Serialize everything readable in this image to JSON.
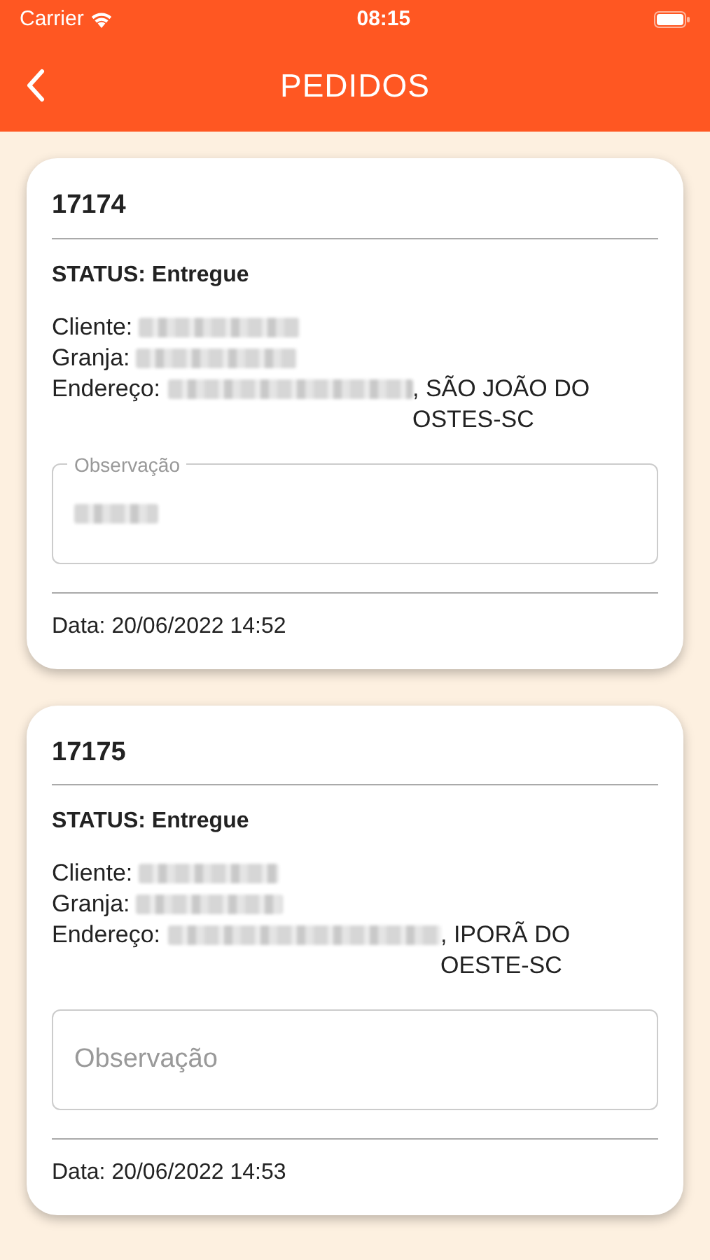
{
  "status_bar": {
    "carrier": "Carrier",
    "time": "08:15"
  },
  "header": {
    "title": "PEDIDOS"
  },
  "orders": [
    {
      "number": "17174",
      "status": "STATUS: Entregue",
      "cliente_label": "Cliente:",
      "granja_label": "Granja:",
      "endereco_label": "Endereço:",
      "endereco_suffix": ", SÃO JOÃO DO OSTES-SC",
      "observacao": {
        "label": "Observação",
        "value_redacted": true
      },
      "date": "Data: 20/06/2022 14:52"
    },
    {
      "number": "17175",
      "status": "STATUS: Entregue",
      "cliente_label": "Cliente:",
      "granja_label": "Granja:",
      "endereco_label": "Endereço:",
      "endereco_suffix": ", IPORÃ DO OESTE-SC",
      "observacao": {
        "placeholder": "Observação",
        "value_redacted": false
      },
      "date": "Data: 20/06/2022 14:53"
    }
  ]
}
